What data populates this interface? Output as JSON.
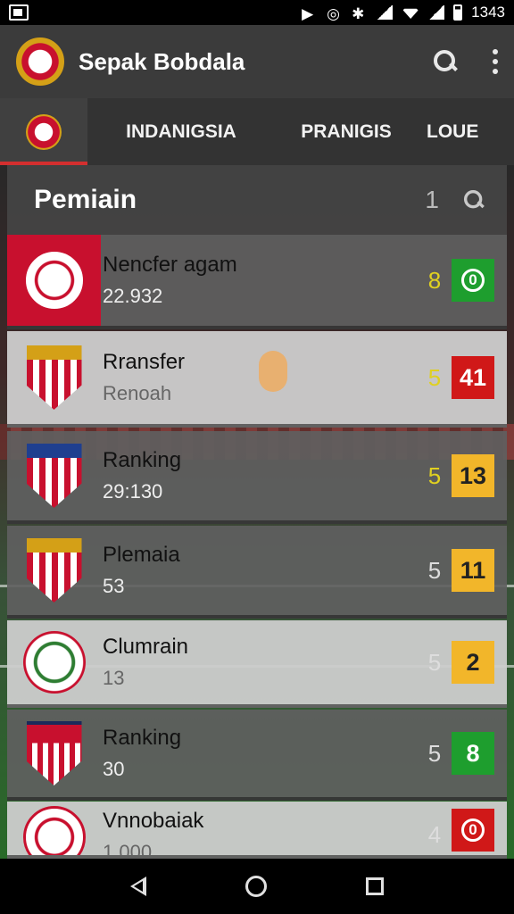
{
  "status_bar": {
    "time": "1343"
  },
  "app_bar": {
    "title": "Sepak Bobdala"
  },
  "tabs": [
    {
      "label": ""
    },
    {
      "label": "INDANIGSIA"
    },
    {
      "label": "PRANIGIS"
    },
    {
      "label": "LOUE"
    }
  ],
  "section": {
    "title": "Pemiain",
    "count": "1"
  },
  "rows": [
    {
      "name": "Nencfer agam",
      "sub": "22.932",
      "rank": "8",
      "score": "0",
      "style": "dark"
    },
    {
      "name": "Rransfer",
      "sub": "Renoah",
      "rank": "5",
      "score": "41",
      "style": "light"
    },
    {
      "name": "Ranking",
      "sub": "29:130",
      "rank": "5",
      "score": "13",
      "style": "dark"
    },
    {
      "name": "Plemaia",
      "sub": "53",
      "rank": "5",
      "score": "11",
      "style": "dark"
    },
    {
      "name": "Clumrain",
      "sub": "13",
      "rank": "5",
      "score": "2",
      "style": "light"
    },
    {
      "name": "Ranking",
      "sub": "30",
      "rank": "5",
      "score": "8",
      "style": "dark"
    },
    {
      "name": "Vnnobaiak",
      "sub": "1.000",
      "rank": "4",
      "score": "0",
      "style": "light"
    }
  ],
  "colors": {
    "accent": "#d32f2f",
    "score_green": "#1e9e2e",
    "score_red": "#d01818",
    "score_amber": "#f2b62a"
  }
}
